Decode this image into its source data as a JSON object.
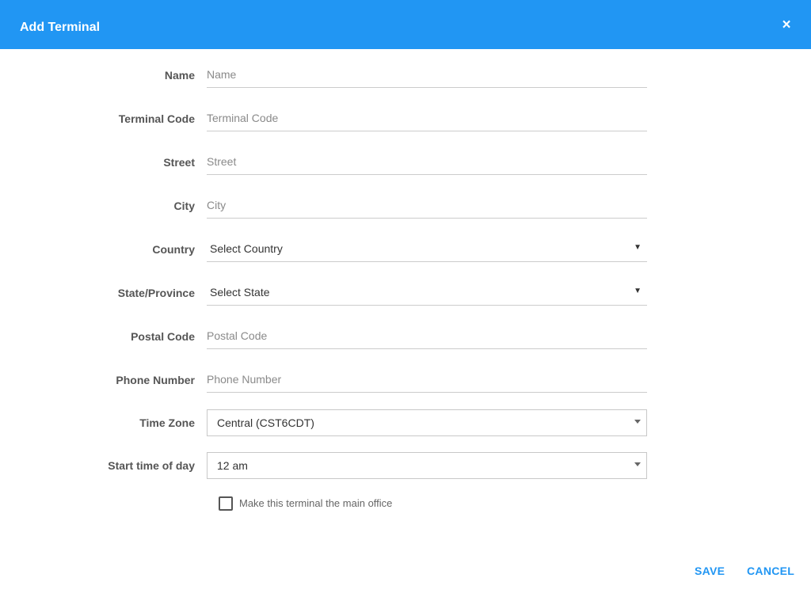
{
  "dialog": {
    "title": "Add Terminal",
    "close_label": "×",
    "accent_color": "#2196f3"
  },
  "form": {
    "name": {
      "label": "Name",
      "placeholder": "Name",
      "value": ""
    },
    "terminal_code": {
      "label": "Terminal Code",
      "placeholder": "Terminal Code",
      "value": ""
    },
    "street": {
      "label": "Street",
      "placeholder": "Street",
      "value": ""
    },
    "city": {
      "label": "City",
      "placeholder": "City",
      "value": ""
    },
    "country": {
      "label": "Country",
      "selected": "Select Country",
      "caret": "▼"
    },
    "state": {
      "label": "State/Province",
      "selected": "Select State",
      "caret": "▼"
    },
    "postal_code": {
      "label": "Postal Code",
      "placeholder": "Postal Code",
      "value": ""
    },
    "phone_number": {
      "label": "Phone Number",
      "placeholder": "Phone Number",
      "value": ""
    },
    "time_zone": {
      "label": "Time Zone",
      "selected": "Central (CST6CDT)"
    },
    "start_time": {
      "label": "Start time of day",
      "selected": "12 am"
    },
    "main_office": {
      "label": "Make this terminal the main office",
      "checked": false
    }
  },
  "footer": {
    "save_label": "SAVE",
    "cancel_label": "CANCEL"
  }
}
